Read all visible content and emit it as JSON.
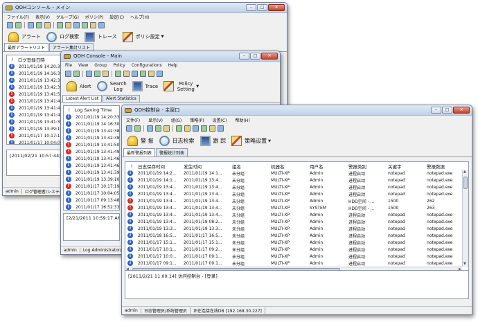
{
  "windows": {
    "jp": {
      "title": "QOHコンソール - メイン",
      "menu": [
        "ファイル(F)",
        "表示(V)",
        "グループ(G)",
        "ポリシ(P)",
        "設定(C)",
        "ヘルプ(H)"
      ],
      "toolbar": [
        "アラート",
        "ログ検索",
        "トレース",
        "ポリシ設定"
      ],
      "tabs": [
        "最新アラートリスト",
        "アラート集計リスト"
      ],
      "columns": [
        "!",
        "ログ登録日時"
      ],
      "rows": [
        {
          "status": "info",
          "time": "2011/01/19 14:20:33"
        },
        {
          "status": "info",
          "time": "2011/01/19 14:16:30"
        },
        {
          "status": "info",
          "time": "2011/01/19 13:42:38"
        },
        {
          "status": "info",
          "time": "2011/01/19 13:42:38"
        },
        {
          "status": "error",
          "time": "2011/01/19 13:41:50"
        },
        {
          "status": "error",
          "time": "2011/01/19 13:41:49"
        },
        {
          "status": "info",
          "time": "2011/01/19 13:41:46"
        },
        {
          "status": "info",
          "time": "2011/01/19 13:41:46"
        },
        {
          "status": "info",
          "time": "2011/01/19 13:41:39"
        },
        {
          "status": "info",
          "time": "2011/01/19 13:39:10"
        },
        {
          "status": "error",
          "time": "2011/01/17 10:17:19"
        },
        {
          "status": "info",
          "time": "2011/01/17 10:04:05"
        },
        {
          "status": "info",
          "time": "2011/01/17 09:13:48"
        }
      ],
      "message": "[2011/02/21 10:57:44] コンソ…",
      "status": [
        "admin",
        "ログ管理者/システム管理"
      ]
    },
    "en": {
      "title": "QOH Console - Main",
      "menu": [
        "File",
        "View",
        "Group",
        "Policy",
        "Configurations",
        "Help"
      ],
      "toolbar": [
        "Alert",
        "Search Log",
        "Trace",
        "Policy Setting"
      ],
      "tabs": [
        "Latest Alert List",
        "Alert Statistics"
      ],
      "columns": [
        "!",
        "Log Saving Time"
      ],
      "rows": [
        {
          "status": "info",
          "time": "2011/01/19 14:20:33"
        },
        {
          "status": "info",
          "time": "2011/01/19 14:16:30"
        },
        {
          "status": "info",
          "time": "2011/01/19 13:42:38"
        },
        {
          "status": "info",
          "time": "2011/01/19 13:42:38"
        },
        {
          "status": "error",
          "time": "2011/01/19 13:41:50"
        },
        {
          "status": "error",
          "time": "2011/01/19 13:41:49"
        },
        {
          "status": "info",
          "time": "2011/01/19 13:41:46"
        },
        {
          "status": "info",
          "time": "2011/01/19 13:41:46"
        },
        {
          "status": "info",
          "time": "2011/01/19 13:41:39"
        },
        {
          "status": "info",
          "time": "2011/01/19 13:39:10"
        },
        {
          "status": "error",
          "time": "2011/01/17 10:17:19"
        },
        {
          "status": "info",
          "time": "2011/01/17 10:04:05"
        },
        {
          "status": "info",
          "time": "2011/01/17 09:13:48"
        },
        {
          "status": "info",
          "time": "2011/01/17 16:52:33"
        },
        {
          "status": "info",
          "time": "2011/01/17 15:11:16"
        },
        {
          "status": "info",
          "time": "2011/01/17 10:12:19"
        },
        {
          "status": "info",
          "time": "2011/01/17 10:04:05"
        },
        {
          "status": "info",
          "time": "2011/01/17 09:13:48"
        },
        {
          "status": "info",
          "time": "2011/01/17 09:13:47"
        },
        {
          "status": "error",
          "time": "2011/01/13 13:51:08"
        }
      ],
      "message": "[2/21/2011 10:59:17 AM] Consol",
      "status": [
        "admin",
        "Log Administrator/System"
      ]
    },
    "cn": {
      "title": "QOH控制台 - 主窗口",
      "menu": [
        "文件(F)",
        "显示(V)",
        "组(G)",
        "策略(P)",
        "设置(C)",
        "帮助(H)"
      ],
      "toolbar": [
        "警  报",
        "日志检索",
        "跟  踪",
        "策略设置"
      ],
      "tabs": [
        "最新警报列表",
        "警报统计列表"
      ],
      "columns": [
        "!",
        "日志保存时间",
        "发生时间",
        "组名",
        "机器名",
        "用户名",
        "警报类别",
        "关键字",
        "警报数据"
      ],
      "rows": [
        {
          "status": "info",
          "cells": [
            "2011/01/19 14:2...",
            "2011/01/19 14:1...",
            "未分组",
            "MULTI-XP",
            "Admin",
            "进程启动",
            "notepad",
            "notepad.exe"
          ]
        },
        {
          "status": "info",
          "cells": [
            "2011/01/19 14:1...",
            "2011/01/19 13:4...",
            "未分组",
            "MULTI-XP",
            "Admin",
            "进程启动",
            "notepad",
            "notepad.exe"
          ]
        },
        {
          "status": "info",
          "cells": [
            "2011/01/19 13:4...",
            "2011/01/19 13:4...",
            "未分组",
            "MULTI-XP",
            "Admin",
            "进程启动",
            "notepad",
            "notepad.exe"
          ]
        },
        {
          "status": "info",
          "cells": [
            "2011/01/19 13:4...",
            "2011/01/19 13:4...",
            "未分组",
            "MULTI-XP",
            "Admin",
            "进程启动",
            "notepad",
            "notepad.exe"
          ]
        },
        {
          "status": "error",
          "cells": [
            "2011/01/19 13:4...",
            "2011/01/19 13:4...",
            "未分组",
            "MULTI-XP",
            "Admin",
            "HDD空间 - ...",
            "1500",
            "262"
          ]
        },
        {
          "status": "error",
          "cells": [
            "2011/01/19 13:4...",
            "2011/01/19 13:4...",
            "未分组",
            "MULTI-XP",
            "SYSTEM",
            "HDD空间 - ...",
            "1500",
            "263"
          ]
        },
        {
          "status": "info",
          "cells": [
            "2011/01/19 13:4...",
            "2011/01/19 13:4...",
            "未分组",
            "MULTI-XP",
            "Admin",
            "进程启动",
            "notepad",
            "notepad.exe"
          ]
        },
        {
          "status": "info",
          "cells": [
            "2011/01/19 13:4...",
            "2011/01/19 08:2...",
            "未分组",
            "MULTI-XP",
            "Admin",
            "进程启动",
            "notepad",
            "notepad.exe"
          ]
        },
        {
          "status": "info",
          "cells": [
            "2011/01/19 13:3...",
            "2011/01/19 13:3...",
            "未分组",
            "MULTI-XP",
            "Admin",
            "进程启动",
            "notepad",
            "notepad.exe"
          ]
        },
        {
          "status": "info",
          "cells": [
            "2011/01/18 16:5...",
            "2011/01/17 16:5...",
            "未分组",
            "MULTI-XP",
            "Admin",
            "进程启动",
            "notepad",
            "notepad.exe"
          ]
        },
        {
          "status": "info",
          "cells": [
            "2011/01/17 15:1...",
            "2011/01/17 15:1...",
            "未分组",
            "MULTI-XP",
            "Admin",
            "进程启动",
            "notepad",
            "notepad.exe"
          ]
        },
        {
          "status": "info",
          "cells": [
            "2011/01/17 10:1...",
            "2011/01/17 09:2...",
            "未分组",
            "MULTI-XP",
            "Admin",
            "进程启动",
            "notepad",
            "notepad.exe"
          ]
        },
        {
          "status": "info",
          "cells": [
            "2011/01/17 10:0...",
            "2011/01/17 09:1...",
            "未分组",
            "MULTI-XP",
            "Admin",
            "进程启动",
            "notepad",
            "notepad.exe"
          ]
        },
        {
          "status": "info",
          "cells": [
            "2011/01/17 09:1...",
            "2011/01/17 09:1...",
            "未分组",
            "MULTI-XP",
            "Admin",
            "进程启动",
            "notepad",
            "notepad.exe"
          ]
        }
      ],
      "message": "[2011/2/21 11:00:14] 访问控制台 - [登录]",
      "status": [
        "admin",
        "日志管理员/系统管理员",
        "正在连接在线DB [192.168.30.227]"
      ]
    }
  },
  "colors": {
    "info": "#2f63c6",
    "error": "#d42a1e"
  }
}
